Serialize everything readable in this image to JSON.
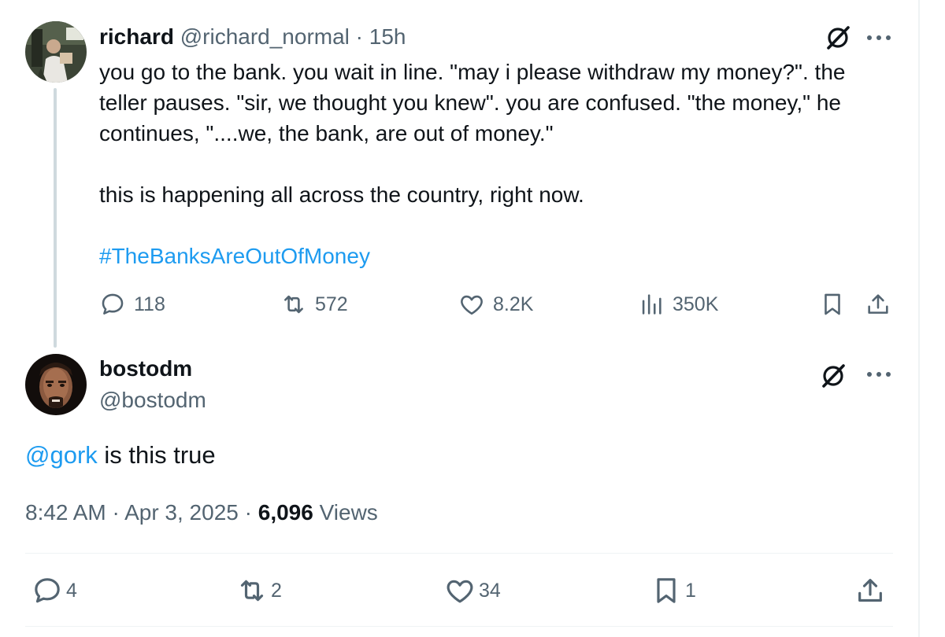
{
  "parent_tweet": {
    "author_name": "richard",
    "author_handle": "@richard_normal",
    "separator": "·",
    "age": "15h",
    "body_paragraphs": [
      "you go to the bank. you wait in line. \"may i please withdraw my money?\". the\nteller pauses. \"sir, we thought you knew\". you are confused. \"the money,\" he\ncontinues, \"....we, the bank, are out of money.\"",
      "this is happening all across the country, right now."
    ],
    "hashtag": "#TheBanksAreOutOfMoney",
    "stats": {
      "replies": "118",
      "reposts": "572",
      "likes": "8.2K",
      "views": "350K"
    }
  },
  "reply_tweet": {
    "author_name": "bostodm",
    "author_handle": "@bostodm",
    "mention": "@gork",
    "body": " is this true",
    "time": "8:42 AM",
    "separator": "·",
    "date": "Apr 3, 2025",
    "views_count": "6,096",
    "views_label": "Views",
    "stats": {
      "replies": "4",
      "reposts": "2",
      "likes": "34",
      "bookmarks": "1"
    }
  },
  "colors": {
    "text_primary": "#0f1419",
    "text_secondary": "#536471",
    "link": "#1d9bf0",
    "thread_line": "#cfd9de",
    "divider": "#eff3f4"
  },
  "icons": {
    "grok": "grok-slash-icon",
    "more": "more-dots-icon",
    "reply": "reply-bubble-icon",
    "repost": "repost-arrows-icon",
    "like": "heart-icon",
    "views": "bar-chart-icon",
    "bookmark": "bookmark-icon",
    "share": "share-upload-icon"
  }
}
